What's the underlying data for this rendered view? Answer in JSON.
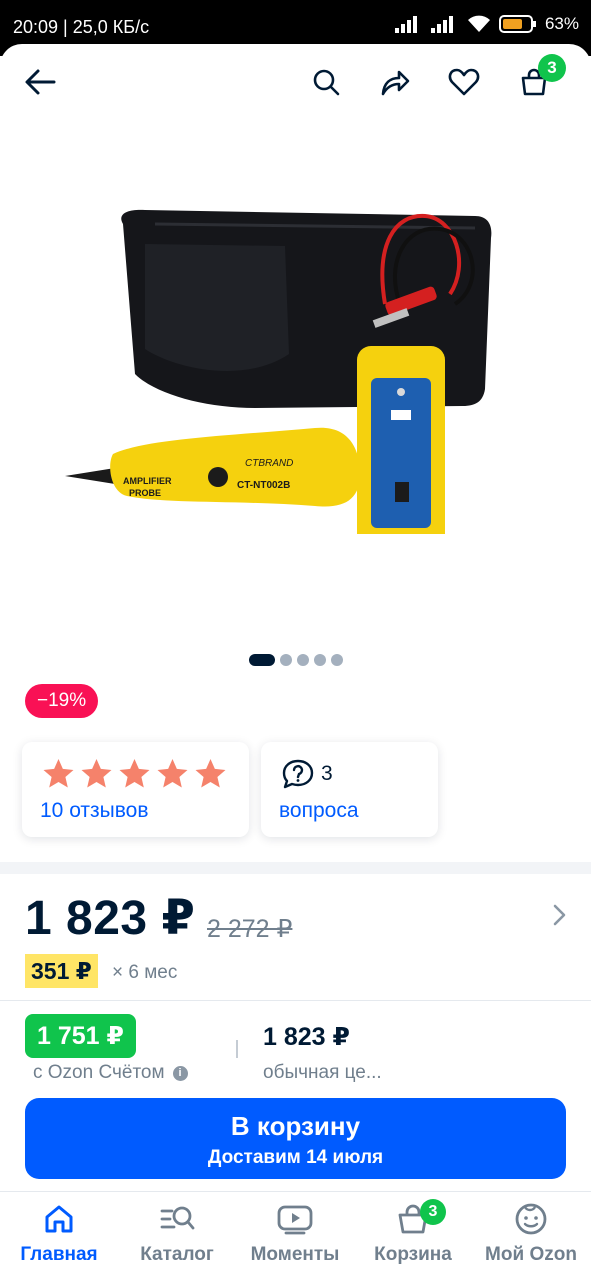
{
  "status_bar": {
    "time": "20:09",
    "speed": "25,0 КБ/с",
    "battery": "63"
  },
  "topbar": {
    "icons": [
      "back-arrow-icon",
      "search-icon",
      "share-icon",
      "heart-icon",
      "cart-icon"
    ],
    "cart_count": "3"
  },
  "product": {
    "image_dots_count": 5,
    "active_dot": 0,
    "image_labels": {
      "brand": "CTBRAND",
      "model": "CT-NT002B",
      "probe_line1": "AMPLIFIER",
      "probe_line2": "PROBE"
    },
    "discount": "−19%",
    "rating": {
      "stars": 5,
      "reviews_label": "10 отзывов"
    },
    "questions": {
      "count": "3",
      "label": "вопроса"
    },
    "price": "1 823 ₽",
    "old_price": "2 272 ₽",
    "installment": {
      "amount": "351 ₽",
      "term": "× 6 мес"
    },
    "ozon_account_price": "1 751 ₽",
    "ozon_account_label": "с Ozon Счётом",
    "regular_price": "1 823 ₽",
    "regular_label": "обычная це..."
  },
  "cta": {
    "label": "В корзину",
    "delivery": "Доставим 14 июля"
  },
  "bottom_nav": {
    "items": [
      {
        "label": "Главная",
        "icon": "home-icon",
        "active": true
      },
      {
        "label": "Каталог",
        "icon": "catalog-search-icon",
        "active": false
      },
      {
        "label": "Моменты",
        "icon": "play-icon",
        "active": false
      },
      {
        "label": "Корзина",
        "icon": "basket-icon",
        "active": false,
        "badge": "3"
      },
      {
        "label": "Мой Ozon",
        "icon": "profile-face-icon",
        "active": false
      }
    ]
  },
  "colors": {
    "accent_blue": "#005bff",
    "discount_pink": "#f91155",
    "green": "#10c44c",
    "star": "#f5826b",
    "installment_yellow": "#ffe566",
    "text_dark": "#001a34",
    "text_muted": "#707f8d"
  }
}
